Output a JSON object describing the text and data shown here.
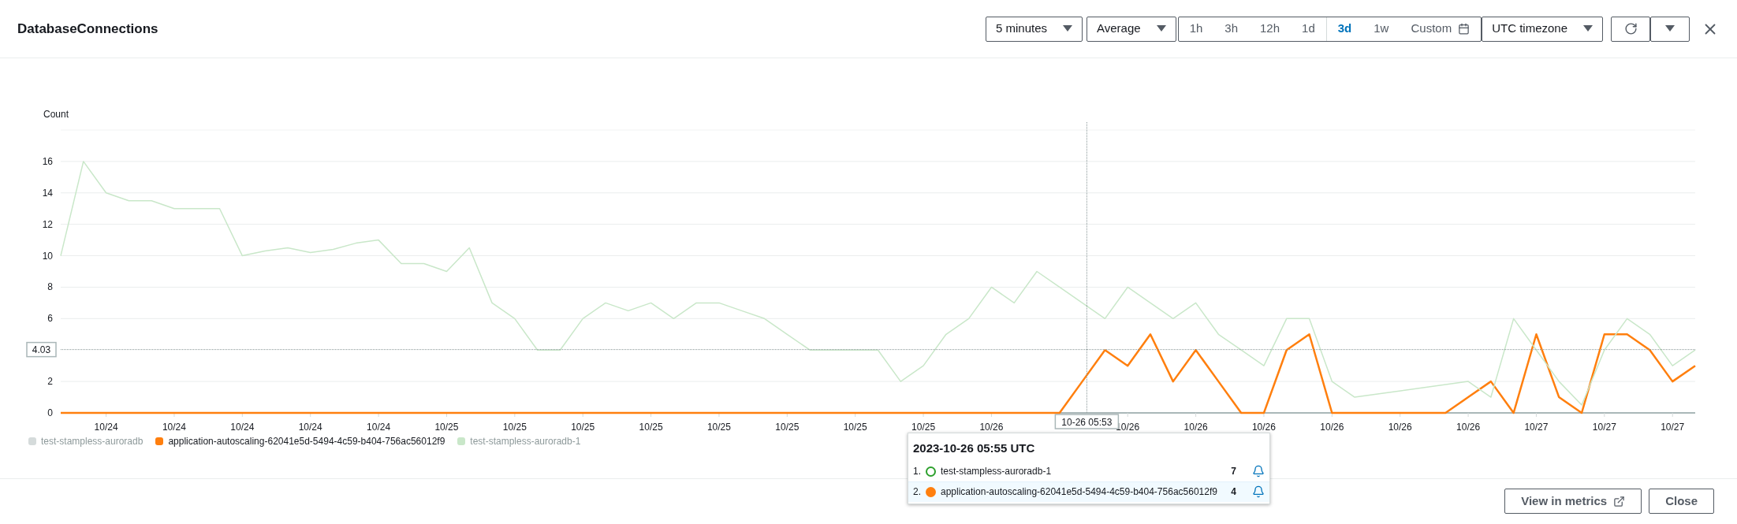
{
  "title": "DatabaseConnections",
  "period": {
    "label": "5 minutes"
  },
  "statistic": {
    "label": "Average"
  },
  "ranges": [
    {
      "label": "1h",
      "kind": "preset",
      "selected": false
    },
    {
      "label": "3h",
      "kind": "preset",
      "selected": false
    },
    {
      "label": "12h",
      "kind": "preset",
      "selected": false
    },
    {
      "label": "1d",
      "kind": "preset",
      "selected": false
    },
    {
      "label": "3d",
      "kind": "preset",
      "selected": true
    },
    {
      "label": "1w",
      "kind": "preset",
      "selected": false
    },
    {
      "label": "Custom",
      "kind": "custom",
      "selected": false
    }
  ],
  "timezone": {
    "label": "UTC timezone"
  },
  "chart": {
    "chart_data": {
      "type": "line",
      "ylabel": "Count",
      "grid": true,
      "ylim": [
        0,
        18
      ],
      "ref_lines": [
        {
          "axis": "y",
          "value": 4.03,
          "label": "4.03"
        }
      ],
      "yticks": [
        0,
        2,
        6,
        8,
        10,
        12,
        14,
        16
      ],
      "categories": [
        null,
        null,
        "10/24",
        null,
        null,
        "10/24",
        null,
        null,
        "10/24",
        null,
        null,
        "10/24",
        null,
        null,
        "10/24",
        null,
        null,
        "10/25",
        null,
        null,
        "10/25",
        null,
        null,
        "10/25",
        null,
        null,
        "10/25",
        null,
        null,
        "10/25",
        null,
        null,
        "10/25",
        null,
        null,
        "10/25",
        null,
        null,
        "10/25",
        null,
        null,
        "10/26",
        null,
        null,
        null,
        null,
        null,
        "10/26",
        null,
        null,
        "10/26",
        null,
        null,
        "10/26",
        null,
        null,
        "10/26",
        null,
        null,
        "10/26",
        null,
        null,
        "10/26",
        null,
        null,
        "10/27",
        null,
        null,
        "10/27",
        null,
        null,
        "10/27",
        null
      ],
      "series": [
        {
          "name": "test-stampless-auroradb",
          "color": "#d5dbdb",
          "values": [
            null,
            null,
            null,
            null,
            null,
            null,
            null,
            null,
            null,
            null,
            null,
            null,
            null,
            null,
            null,
            null,
            null,
            null,
            null,
            null,
            null,
            null,
            null,
            null,
            null,
            null,
            null,
            null,
            null,
            null,
            null,
            null,
            null,
            null,
            null,
            null,
            null,
            null,
            null,
            null,
            null,
            null,
            null,
            null,
            null,
            null,
            null,
            null,
            null,
            null,
            null,
            null,
            null,
            null,
            null,
            null,
            null,
            null,
            null,
            null,
            null,
            null,
            null,
            null,
            null,
            null,
            null,
            null,
            null,
            null,
            null,
            null,
            null
          ]
        },
        {
          "name": "application-autoscaling-62041e5d-5494-4c59-b404-756ac56012f9",
          "color": "#ff7f0e",
          "values": [
            0,
            0,
            0,
            0,
            0,
            0,
            0,
            0,
            0,
            0,
            0,
            0,
            0,
            0,
            0,
            0,
            0,
            0,
            0,
            0,
            0,
            0,
            0,
            0,
            0,
            0,
            0,
            0,
            0,
            0,
            0,
            0,
            0,
            0,
            0,
            0,
            0,
            0,
            0,
            0,
            0,
            0,
            0,
            0,
            0,
            2,
            4,
            3,
            5,
            2,
            4,
            2,
            0,
            0,
            4,
            5,
            0,
            0,
            0,
            0,
            0,
            0,
            1,
            2,
            0,
            5,
            1,
            0,
            5,
            5,
            4,
            2,
            3
          ]
        },
        {
          "name": "test-stampless-auroradb-1",
          "color": "#c9e7c9",
          "values": [
            10,
            16,
            14,
            13.5,
            13.5,
            13,
            13,
            13,
            10,
            10.3,
            10.5,
            10.2,
            10.4,
            10.8,
            11,
            9.5,
            9.5,
            9,
            10.5,
            7,
            6,
            4,
            4,
            6,
            7,
            6.5,
            7,
            6,
            7,
            7,
            6.5,
            6,
            5,
            4,
            4,
            4,
            4,
            2,
            3,
            5,
            6,
            8,
            7,
            9,
            8,
            7,
            6,
            8,
            7,
            6,
            7,
            5,
            4,
            3,
            6,
            6,
            2,
            1,
            null,
            null,
            null,
            null,
            2,
            1,
            6,
            4,
            2,
            0.5,
            4,
            6,
            5,
            3,
            4
          ]
        }
      ]
    },
    "time_marker": {
      "label": "10-26 05:53"
    },
    "legend": [
      {
        "dimmed": true
      },
      {
        "dimmed": false
      },
      {
        "dimmed": true
      }
    ]
  },
  "tooltip": {
    "title": "2023-10-26 05:55 UTC",
    "rows": [
      {
        "index": "1.",
        "kind": "hollow",
        "color": "#2ca02c",
        "name": "test-stampless-auroradb-1",
        "value": "7",
        "selected": false
      },
      {
        "index": "2.",
        "kind": "filled",
        "color": "#ff7f0e",
        "name": "application-autoscaling-62041e5d-5494-4c59-b404-756ac56012f9",
        "value": "4",
        "selected": true
      }
    ]
  },
  "buttons": [
    {
      "label": "View in metrics",
      "kind": "external"
    },
    {
      "label": "Close",
      "kind": "plain"
    }
  ]
}
